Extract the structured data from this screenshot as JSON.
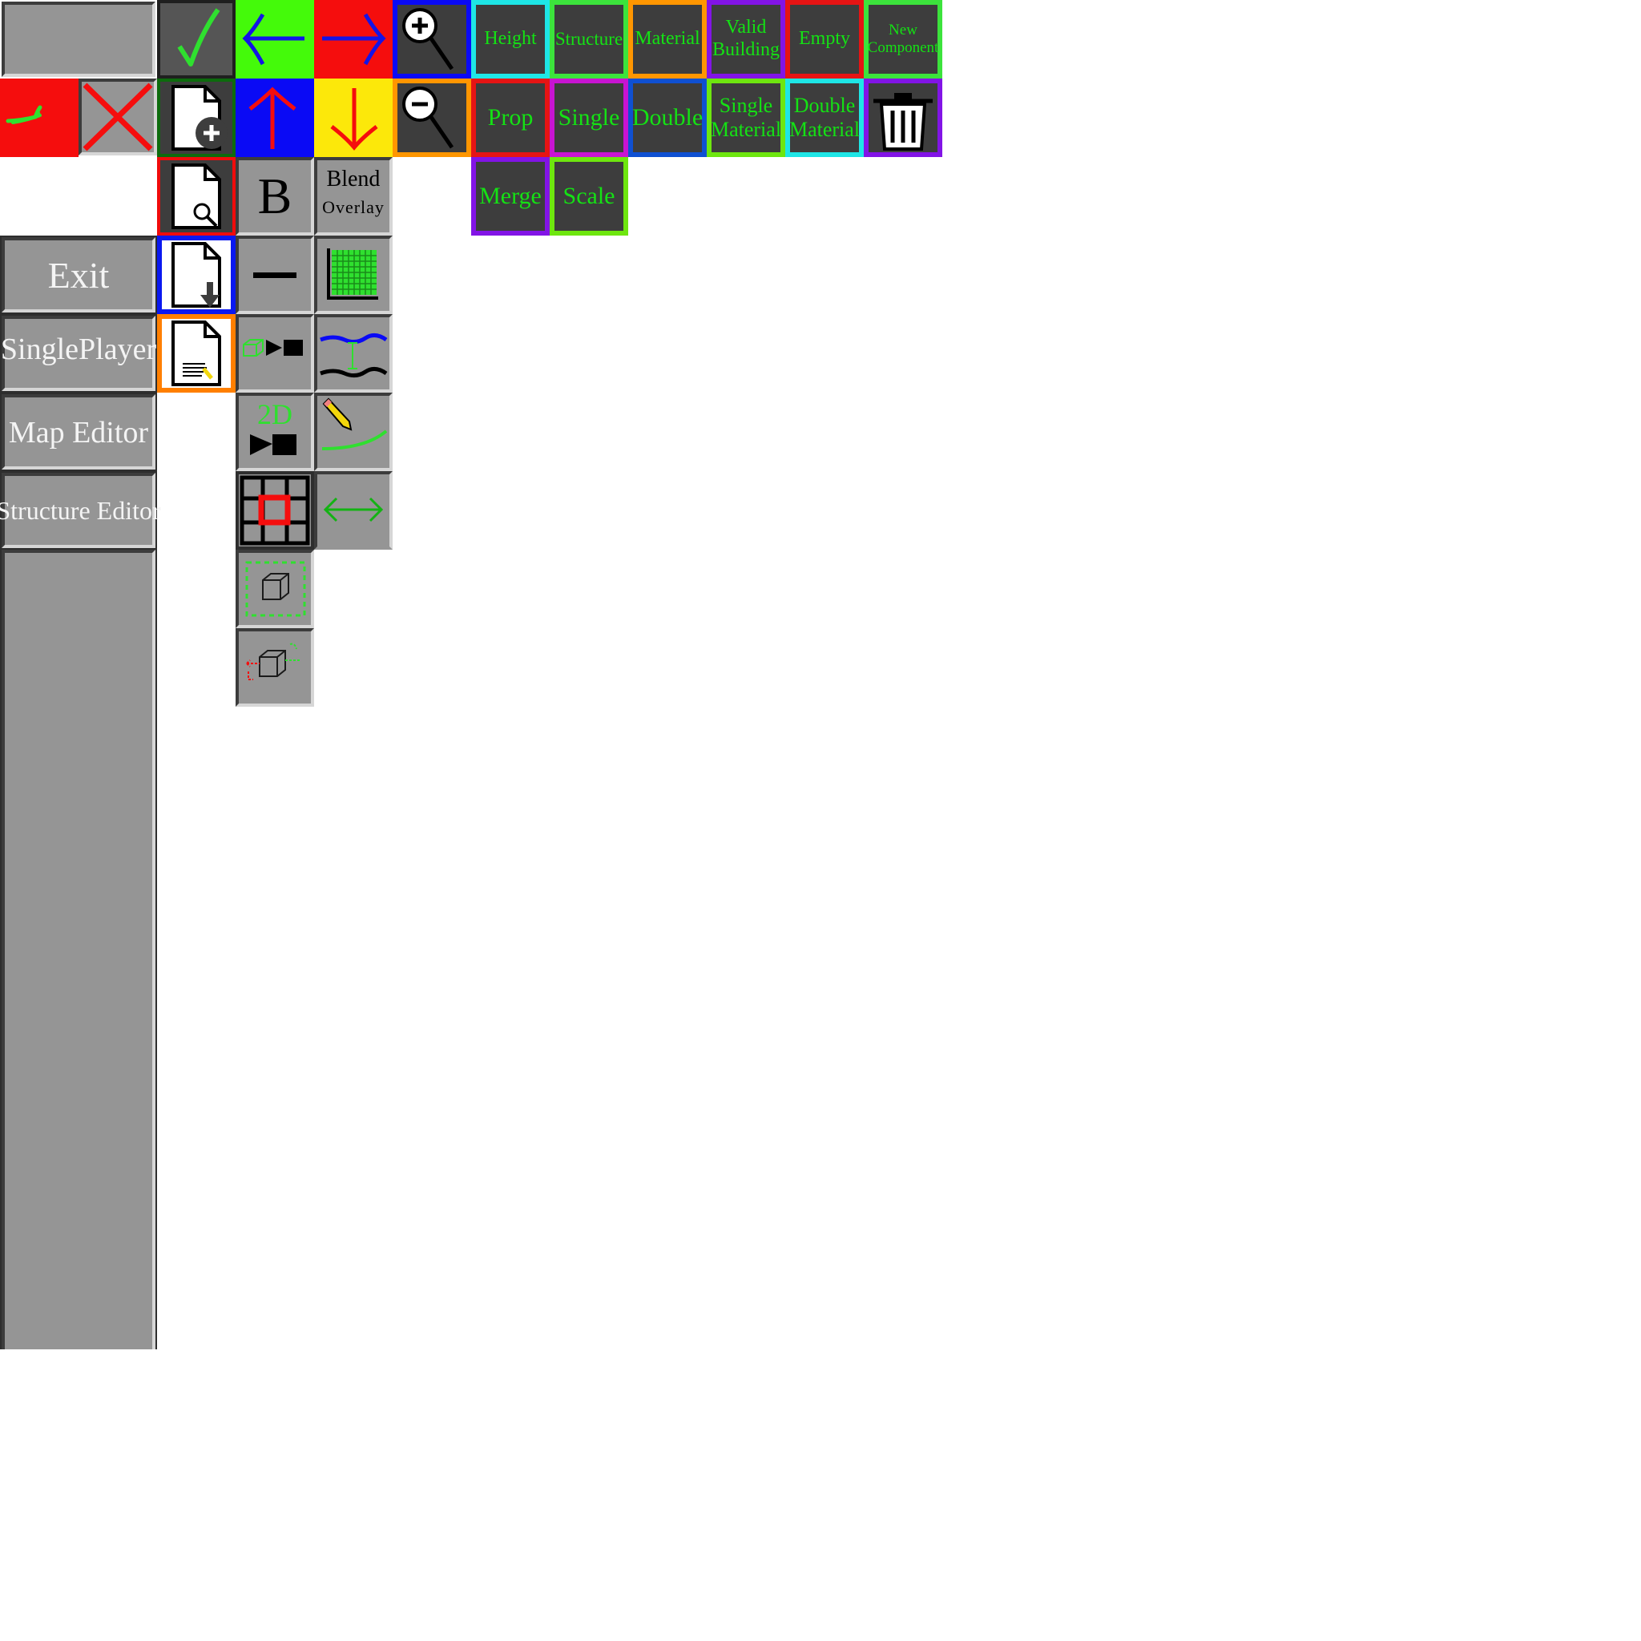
{
  "menu": {
    "exit": "Exit",
    "singleplayer": "SinglePlayer",
    "map_editor": "Map Editor",
    "structure_editor": "Structure Editor"
  },
  "mode_buttons": {
    "height": "Height",
    "structure": "Structure",
    "material": "Material",
    "valid_building": "Valid Building",
    "empty": "Empty",
    "new_component": "New Component",
    "prop": "Prop",
    "single": "Single",
    "double": "Double",
    "single_material": "Single Material",
    "double_material": "Double Material",
    "merge": "Merge",
    "scale": "Scale"
  },
  "tools": {
    "bold": "B",
    "blend": "Blend",
    "overlay": "Overlay",
    "two_d": "2D"
  },
  "icons": [
    "check-icon",
    "left-arrow-icon",
    "right-arrow-icon",
    "zoom-in-icon",
    "zoom-out-icon",
    "up-arrow-icon",
    "down-arrow-icon",
    "cancel-x-icon",
    "new-file-icon",
    "open-file-icon",
    "save-file-icon",
    "edit-file-icon",
    "trash-icon",
    "minus-icon",
    "grid-icon",
    "camera-3d-icon",
    "layer-height-icon",
    "camera-2d-icon",
    "pencil-curve-icon",
    "grid-select-icon",
    "horizontal-resize-icon",
    "box-select-icon",
    "box-move-icon"
  ],
  "colors": {
    "button_grey": "#959595",
    "dark_tile": "#3d3d3d",
    "label_green": "#14e214",
    "menu_text": "#f4f4f4"
  }
}
